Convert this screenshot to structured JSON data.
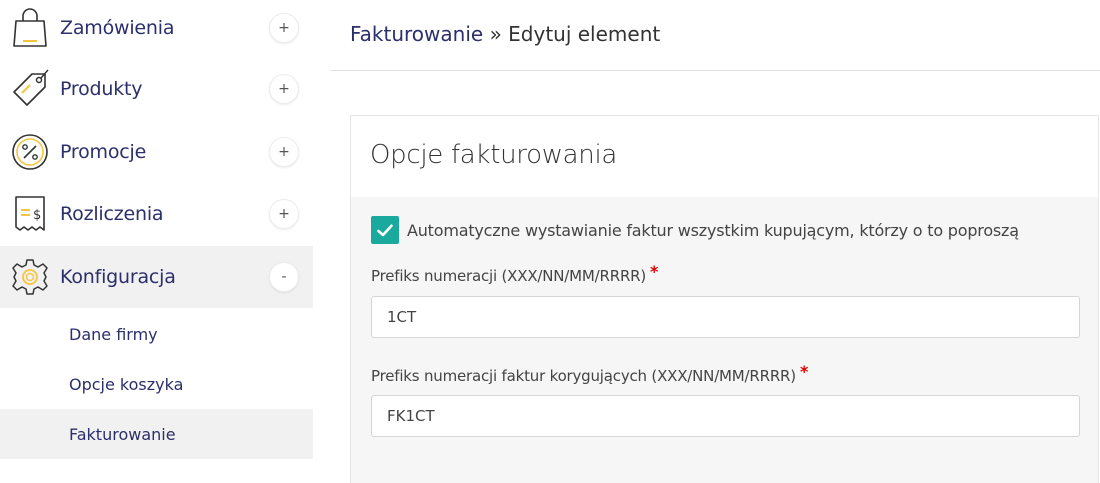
{
  "sidebar": {
    "items": [
      {
        "label": "Zamówienia",
        "icon": "shopping-bag-icon",
        "toggle": "+"
      },
      {
        "label": "Produkty",
        "icon": "price-tag-icon",
        "toggle": "+"
      },
      {
        "label": "Promocje",
        "icon": "percent-badge-icon",
        "toggle": "+"
      },
      {
        "label": "Rozliczenia",
        "icon": "receipt-dollar-icon",
        "toggle": "+"
      },
      {
        "label": "Konfiguracja",
        "icon": "gear-icon",
        "toggle": "-"
      }
    ],
    "subitems": [
      {
        "label": "Dane firmy"
      },
      {
        "label": "Opcje koszyka"
      },
      {
        "label": "Fakturowanie"
      }
    ]
  },
  "header": {
    "breadcrumb_link": "Fakturowanie",
    "separator": "»",
    "current": "Edytuj element"
  },
  "panel": {
    "title": "Opcje fakturowania",
    "auto_invoice": {
      "label": "Automatyczne wystawianie faktur wszystkim kupującym, którzy o to poproszą",
      "checked": true
    },
    "prefix": {
      "label": "Prefiks numeracji (XXX/NN/MM/RRRR)",
      "required_mark": "*",
      "value": "1CT"
    },
    "correction_prefix": {
      "label": "Prefiks numeracji faktur korygujących (XXX/NN/MM/RRRR)",
      "required_mark": "*",
      "value": "FK1CT"
    }
  },
  "colors": {
    "nav_text": "#2b2f6b",
    "accent_yellow": "#f5c542",
    "checkbox_teal": "#1aa99d",
    "required_red": "#e00000",
    "active_bg": "#f1f1f1"
  }
}
